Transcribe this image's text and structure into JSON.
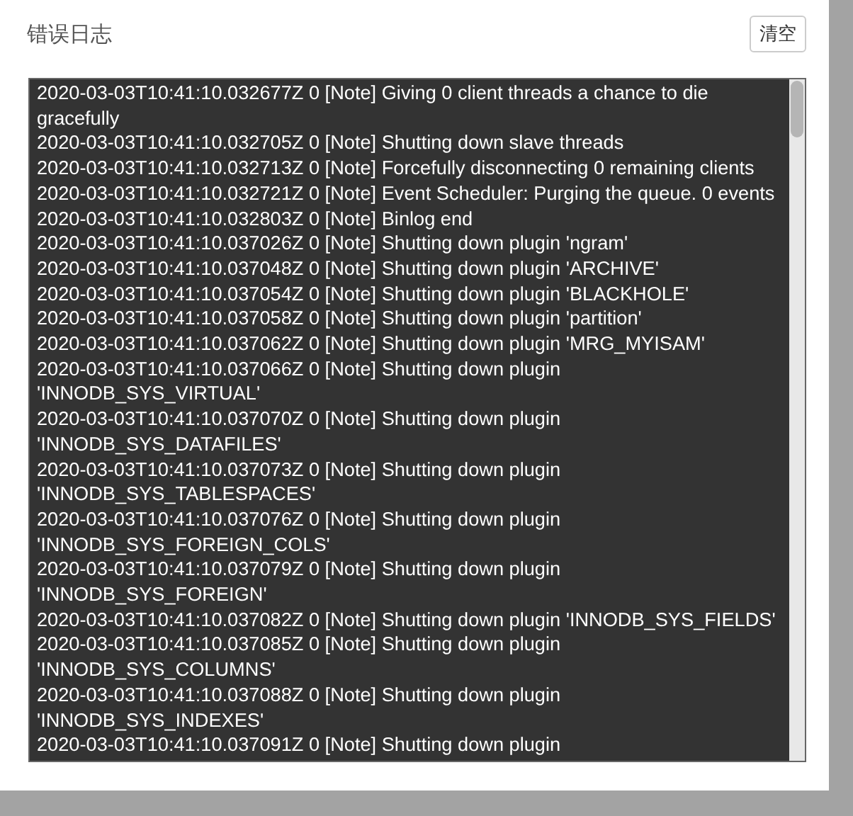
{
  "dialog": {
    "title": "错误日志",
    "clear_button": "清空"
  },
  "log_lines": [
    "2020-03-03T10:41:10.032677Z 0 [Note] Giving 0 client threads a chance to die gracefully",
    "2020-03-03T10:41:10.032705Z 0 [Note] Shutting down slave threads",
    "2020-03-03T10:41:10.032713Z 0 [Note] Forcefully disconnecting 0 remaining clients",
    "2020-03-03T10:41:10.032721Z 0 [Note] Event Scheduler: Purging the queue. 0 events",
    "2020-03-03T10:41:10.032803Z 0 [Note] Binlog end",
    "2020-03-03T10:41:10.037026Z 0 [Note] Shutting down plugin 'ngram'",
    "2020-03-03T10:41:10.037048Z 0 [Note] Shutting down plugin 'ARCHIVE'",
    "2020-03-03T10:41:10.037054Z 0 [Note] Shutting down plugin 'BLACKHOLE'",
    "2020-03-03T10:41:10.037058Z 0 [Note] Shutting down plugin 'partition'",
    "2020-03-03T10:41:10.037062Z 0 [Note] Shutting down plugin 'MRG_MYISAM'",
    "2020-03-03T10:41:10.037066Z 0 [Note] Shutting down plugin 'INNODB_SYS_VIRTUAL'",
    "2020-03-03T10:41:10.037070Z 0 [Note] Shutting down plugin 'INNODB_SYS_DATAFILES'",
    "2020-03-03T10:41:10.037073Z 0 [Note] Shutting down plugin 'INNODB_SYS_TABLESPACES'",
    "2020-03-03T10:41:10.037076Z 0 [Note] Shutting down plugin 'INNODB_SYS_FOREIGN_COLS'",
    "2020-03-03T10:41:10.037079Z 0 [Note] Shutting down plugin 'INNODB_SYS_FOREIGN'",
    "2020-03-03T10:41:10.037082Z 0 [Note] Shutting down plugin 'INNODB_SYS_FIELDS'",
    "2020-03-03T10:41:10.037085Z 0 [Note] Shutting down plugin 'INNODB_SYS_COLUMNS'",
    "2020-03-03T10:41:10.037088Z 0 [Note] Shutting down plugin 'INNODB_SYS_INDEXES'",
    "2020-03-03T10:41:10.037091Z 0 [Note] Shutting down plugin"
  ]
}
